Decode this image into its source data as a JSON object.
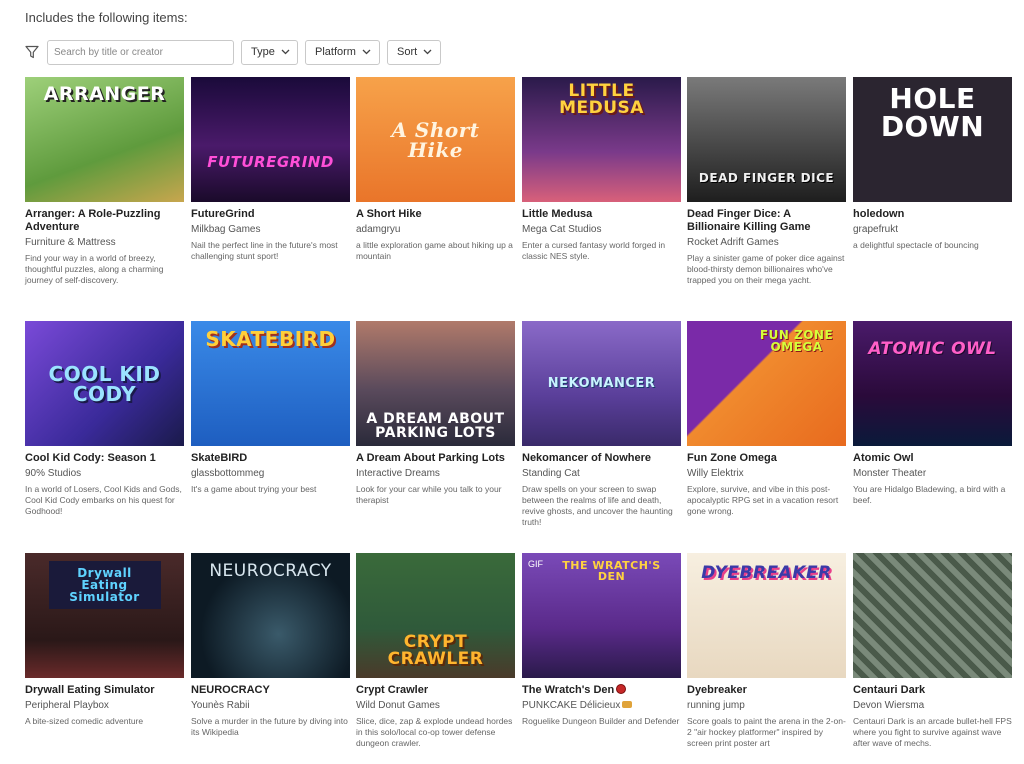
{
  "header": {
    "title": "Includes the following items:"
  },
  "filters": {
    "search_placeholder": "Search by title or creator",
    "type_label": "Type",
    "platform_label": "Platform",
    "sort_label": "Sort"
  },
  "items": [
    {
      "title": "Arranger: A Role-Puzzling Adventure",
      "author": "Furniture & Mattress",
      "desc": "Find your way in a world of breezy, thoughtful puzzles, along a charming journey of self-discovery.",
      "thumb_text": "ARRANGER",
      "bg": "#7fb35a",
      "fg": "#ffffff"
    },
    {
      "title": "FutureGrind",
      "author": "Milkbag Games",
      "desc": "Nail the perfect line in the future's most challenging stunt sport!",
      "thumb_text": "FUTUREGRIND",
      "bg": "#2a0f4a",
      "fg": "#ff4fd8"
    },
    {
      "title": "A Short Hike",
      "author": "adamgryu",
      "desc": "a little exploration game about hiking up a mountain",
      "thumb_text": "A Short Hike",
      "bg": "#f08a2e",
      "fg": "#fff4e0"
    },
    {
      "title": "Little Medusa",
      "author": "Mega Cat Studios",
      "desc": "Enter a cursed fantasy world forged in classic NES style.",
      "thumb_text": "LITTLE MEDUSA",
      "bg": "#3b2a5a",
      "fg": "#ffd23f"
    },
    {
      "title": "Dead Finger Dice: A Billionaire Killing Game",
      "author": "Rocket Adrift Games",
      "desc": "Play a sinister game of poker dice against blood-thirsty demon billionaires who've trapped you on their mega yacht.",
      "thumb_text": "DEAD FINGER DICE",
      "bg": "#4a4a4a",
      "fg": "#e8e8e8"
    },
    {
      "title": "holedown",
      "author": "grapefrukt",
      "desc": "a delightful spectacle of bouncing",
      "thumb_text": "HOLE DOWN",
      "bg": "#2b2530",
      "fg": "#ffffff"
    },
    {
      "title": "Cool Kid Cody: Season 1",
      "author": "90% Studios",
      "desc": "In a world of Losers, Cool Kids and Gods, Cool Kid Cody embarks on his quest for Godhood!",
      "thumb_text": "COOL KID CODY",
      "bg": "#5a3fb8",
      "fg": "#9be3ff"
    },
    {
      "title": "SkateBIRD",
      "author": "glassbottommeg",
      "desc": "It's a game about trying your best",
      "thumb_text": "SKATEBIRD",
      "bg": "#2f7de0",
      "fg": "#ffcf3a"
    },
    {
      "title": "A Dream About Parking Lots",
      "author": "Interactive Dreams",
      "desc": "Look for your car while you talk to your therapist",
      "thumb_text": "A DREAM ABOUT PARKING LOTS",
      "bg": "#5a4a5c",
      "fg": "#ffffff"
    },
    {
      "title": "Nekomancer of Nowhere",
      "author": "Standing Cat",
      "desc": "Draw spells on your screen to swap between the realms of life and death, revive ghosts, and uncover the haunting truth!",
      "thumb_text": "NEKOMANCER",
      "bg": "#6b4fa8",
      "fg": "#c9f3ff"
    },
    {
      "title": "Fun Zone Omega",
      "author": "Willy Elektrix",
      "desc": "Explore, survive, and vibe in this post-apocalyptic RPG set in a vacation resort gone wrong.",
      "thumb_text": "FUN ZONE OMEGA",
      "bg": "#e07020",
      "fg": "#d4ff3a"
    },
    {
      "title": "Atomic Owl",
      "author": "Monster Theater",
      "desc": "You are Hidalgo Bladewing, a bird with a beef.",
      "thumb_text": "ATOMIC OWL",
      "bg": "#3a1250",
      "fg": "#ff5fc8"
    },
    {
      "title": "Drywall Eating Simulator",
      "author": "Peripheral Playbox",
      "desc": "A bite-sized comedic adventure",
      "thumb_text": "Drywall Eating Simulator",
      "bg": "#3a1f1f",
      "fg": "#5fd3ff"
    },
    {
      "title": "NEUROCRACY",
      "author": "Younès Rabii",
      "desc": "Solve a murder in the future by diving into its Wikipedia",
      "thumb_text": "NEUROCRACY",
      "bg": "#0d1a24",
      "fg": "#d8e6ee"
    },
    {
      "title": "Crypt Crawler",
      "author": "Wild Donut Games",
      "desc": "Slice, dice, zap & explode undead hordes in this solo/local co-op tower defense dungeon crawler.",
      "thumb_text": "CRYPT CRAWLER",
      "bg": "#2f5a3a",
      "fg": "#ffb52e"
    },
    {
      "title": "The Wratch's Den",
      "author": "PUNKCAKE Délicieux",
      "desc": "Roguelike Dungeon Builder and Defender",
      "thumb_text": "THE WRATCH'S DEN",
      "bg": "#6a3aa0",
      "fg": "#ffd23f",
      "gif": "GIF"
    },
    {
      "title": "Dyebreaker",
      "author": "running jump",
      "desc": "Score goals to paint the arena in the 2-on-2 \"air hockey platformer\" inspired by screen print poster art",
      "thumb_text": "DYEBREAKER",
      "bg": "#f2e6d2",
      "fg": "#3a3aa8"
    },
    {
      "title": "Centauri Dark",
      "author": "Devon Wiersma",
      "desc": "Centauri Dark is an arcade bullet-hell FPS where you fight to survive against wave after wave of mechs.",
      "thumb_text": "",
      "bg": "#5a6a5a",
      "fg": "#ffffff"
    }
  ]
}
